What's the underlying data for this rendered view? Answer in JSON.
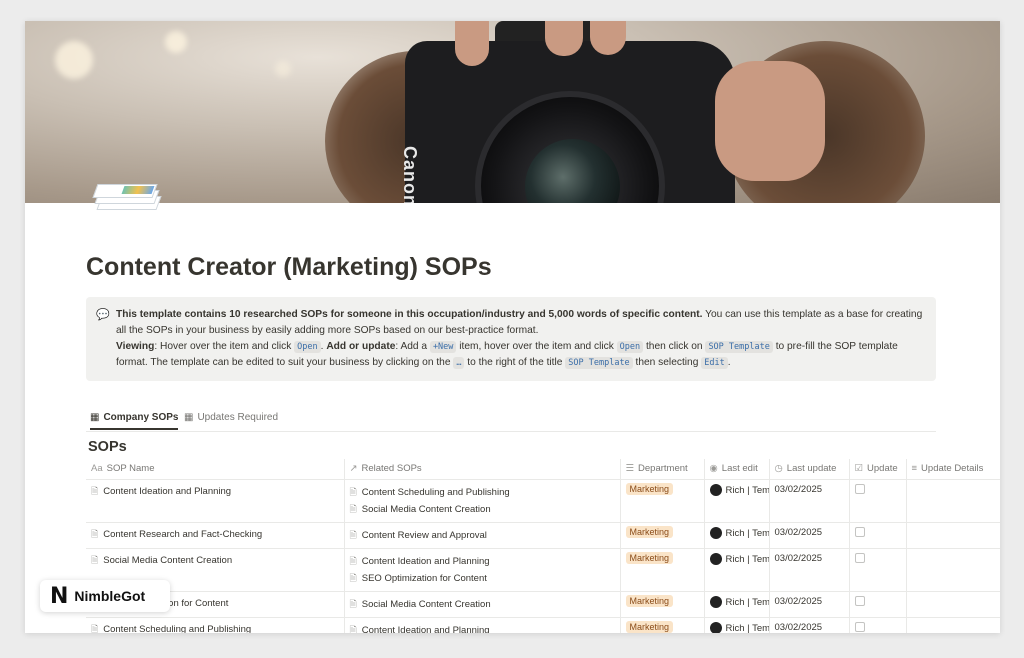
{
  "page": {
    "title": "Content Creator (Marketing) SOPs"
  },
  "callout": {
    "icon": "speech-bubble-icon",
    "line1_bold": "This template contains 10 researched SOPs for someone in this occupation/industry and 5,000 words of specific content.",
    "line1_rest": " You can use this template as a base for creating all the SOPs in your business by easily adding more SOPs based on our best-practice format.",
    "viewing_label": "Viewing",
    "viewing_text": ": Hover over the item and click ",
    "open_code": "Open",
    "add_label": "Add or update",
    "add_text": ": Add a ",
    "new_code": "+New",
    "add_text2": " item, hover over the item and click ",
    "open_code2": "Open",
    "add_text3": " then click on ",
    "sop_code": "SOP Template",
    "add_text4": " to pre-fill the SOP template format. The template can be edited to suit your business by clicking on the ",
    "dots_code": "…",
    "add_text5": " to the right of the title ",
    "sop_code2": "SOP Template",
    "add_text6": " then selecting ",
    "edit_code": "Edit",
    "add_text7": "."
  },
  "tabs": [
    {
      "label": "Company SOPs",
      "icon": "table-icon",
      "active": true
    },
    {
      "label": "Updates Required",
      "icon": "table-icon",
      "active": false
    }
  ],
  "database": {
    "title": "SOPs",
    "columns": [
      {
        "label": "SOP Name",
        "icon": "Aa"
      },
      {
        "label": "Related SOPs",
        "icon": "↗"
      },
      {
        "label": "Department",
        "icon": "☰"
      },
      {
        "label": "Last edit",
        "icon": "◉"
      },
      {
        "label": "Last update",
        "icon": "◷"
      },
      {
        "label": "Update",
        "icon": "☑"
      },
      {
        "label": "Update Details",
        "icon": "≡"
      }
    ],
    "rows": [
      {
        "name": "Content Ideation and Planning",
        "related": [
          "Content Scheduling and Publishing",
          "Social Media Content Creation"
        ],
        "department": "Marketing",
        "editor": "Rich | Tem",
        "updated": "03/02/2025"
      },
      {
        "name": "Content Research and Fact-Checking",
        "related": [
          "Content Review and Approval"
        ],
        "department": "Marketing",
        "editor": "Rich | Tem",
        "updated": "03/02/2025"
      },
      {
        "name": "Social Media Content Creation",
        "related": [
          "Content Ideation and Planning",
          "SEO Optimization for Content"
        ],
        "department": "Marketing",
        "editor": "Rich | Tem",
        "updated": "03/02/2025"
      },
      {
        "name": "SEO Optimization for Content",
        "related": [
          "Social Media Content Creation"
        ],
        "department": "Marketing",
        "editor": "Rich | Tem",
        "updated": "03/02/2025"
      },
      {
        "name": "Content Scheduling and Publishing",
        "related": [
          "Content Ideation and Planning"
        ],
        "department": "Marketing",
        "editor": "Rich | Tem",
        "updated": "03/02/2025"
      }
    ]
  },
  "brand": {
    "logo": "N",
    "name": "NimbleGot"
  },
  "colors": {
    "badge_bg": "#fae4c8",
    "badge_text": "#8b4d1a",
    "callout_bg": "#f1f1ef",
    "code_text": "#3b6ea8"
  }
}
